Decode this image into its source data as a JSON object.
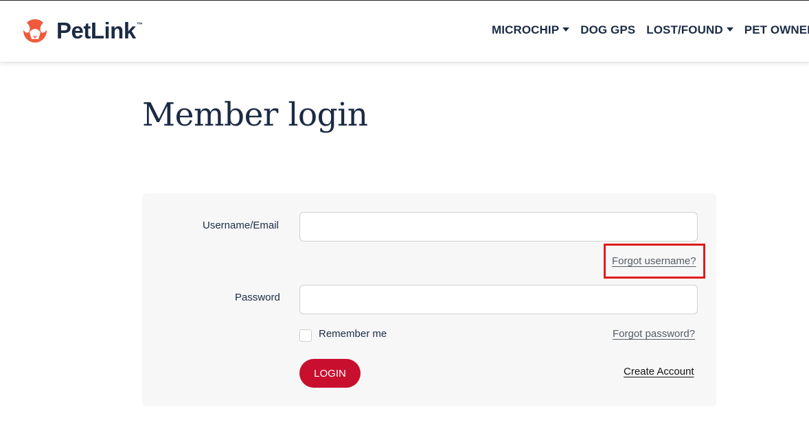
{
  "header": {
    "logo_text": "PetLink",
    "logo_tm": "™",
    "nav": [
      {
        "label": "MICROCHIP",
        "has_dropdown": true
      },
      {
        "label": "DOG GPS",
        "has_dropdown": false
      },
      {
        "label": "LOST/FOUND",
        "has_dropdown": true
      },
      {
        "label": "PET OWNER",
        "has_dropdown": false
      }
    ]
  },
  "page": {
    "title": "Member login"
  },
  "form": {
    "username_label": "Username/Email",
    "username_value": "",
    "forgot_username": "Forgot username?",
    "password_label": "Password",
    "password_value": "",
    "remember_label": "Remember me",
    "forgot_password": "Forgot password?",
    "login_label": "LOGIN",
    "create_account": "Create Account"
  },
  "colors": {
    "brand_navy": "#1c2b44",
    "brand_red": "#c8102e",
    "logo_orange": "#f05a3c",
    "highlight": "#e01b1b"
  }
}
